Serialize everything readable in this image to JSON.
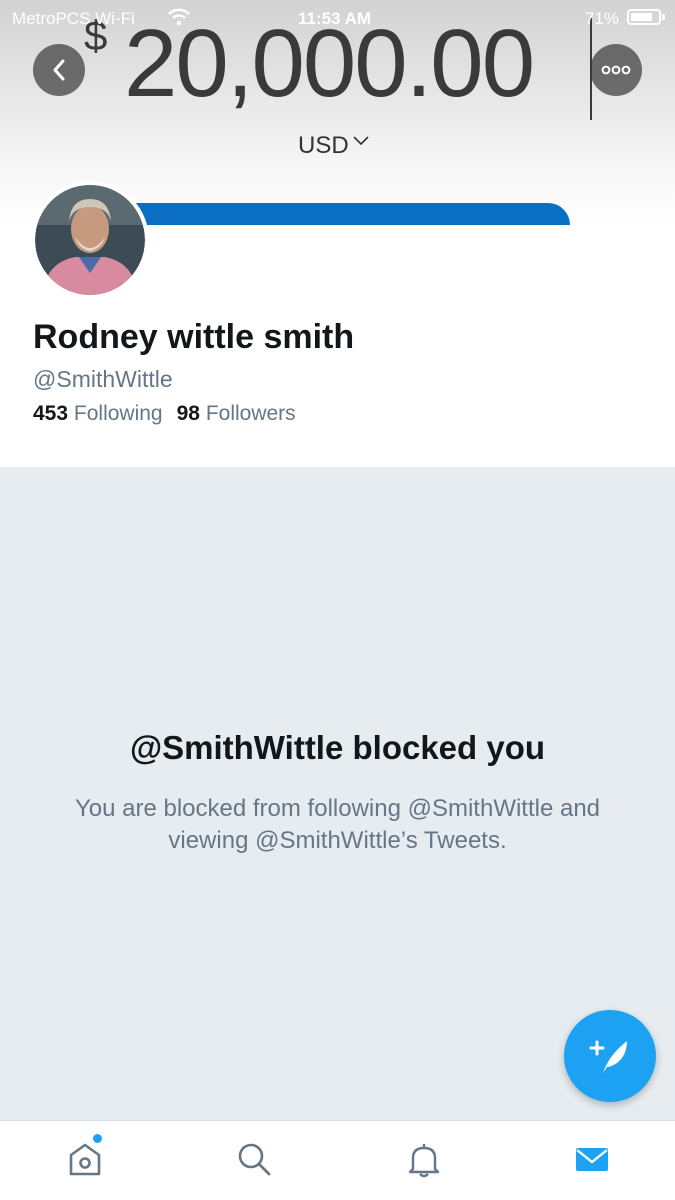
{
  "status_bar": {
    "carrier": "MetroPCS Wi-Fi",
    "time": "11:53 AM",
    "battery_percent": "71%",
    "battery_level": 0.71
  },
  "header": {
    "currency_symbol": "$",
    "amount": "20,000.00",
    "currency": "USD",
    "banner_color": "#0a6fc2"
  },
  "profile": {
    "name": "Rodney wittle smith",
    "handle": "@SmithWittle",
    "following_count": "453",
    "following_label": "Following",
    "followers_count": "98",
    "followers_label": "Followers"
  },
  "blocked": {
    "title": "@SmithWittle blocked you",
    "message": "You are blocked from following @SmithWittle and viewing @SmithWittle’s Tweets."
  },
  "tabbar": {
    "items": [
      "home-icon",
      "search-icon",
      "bell-icon",
      "mail-icon"
    ],
    "active": "mail-icon",
    "accent": "#1da1f2"
  }
}
